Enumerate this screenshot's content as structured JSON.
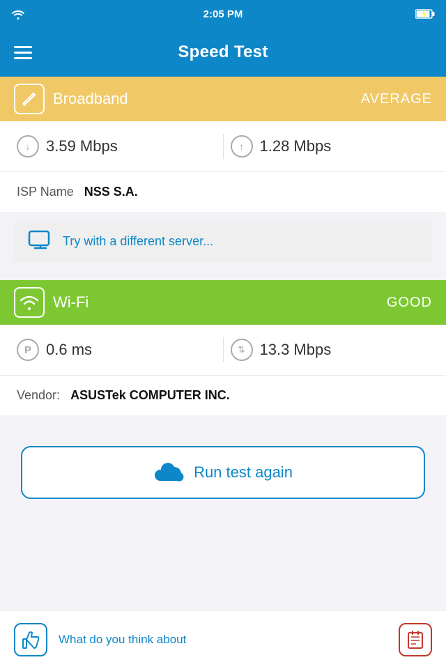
{
  "statusBar": {
    "time": "2:05 PM"
  },
  "header": {
    "title": "Speed Test",
    "menuLabel": "Menu"
  },
  "broadband": {
    "sectionLabel": "Broadband",
    "badge": "AVERAGE",
    "download": "3.59 Mbps",
    "upload": "1.28 Mbps",
    "ispLabel": "ISP Name",
    "ispValue": "NSS S.A.",
    "serverText": "Try with a different server..."
  },
  "wifi": {
    "sectionLabel": "Wi-Fi",
    "badge": "GOOD",
    "ping": "0.6 ms",
    "speed": "13.3 Mbps",
    "vendorLabel": "Vendor:",
    "vendorValue": "ASUSTek COMPUTER INC."
  },
  "runTest": {
    "label": "Run test again"
  },
  "feedback": {
    "text": "What do you think about"
  }
}
